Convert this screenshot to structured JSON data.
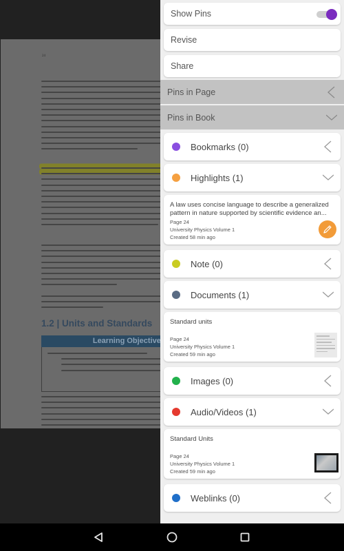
{
  "reader": {
    "page_number": "24",
    "section_heading": "1.2 | Units and Standards",
    "learning_box_label": "Learning Objectives",
    "highlight_color": "#86861f"
  },
  "panel": {
    "options": [
      {
        "label": "Show Pins",
        "toggle": true,
        "toggle_on": true
      },
      {
        "label": "Revise"
      },
      {
        "label": "Share"
      }
    ],
    "sections": [
      {
        "label": "Pins in Page",
        "state": "collapsed"
      },
      {
        "label": "Pins in Book",
        "state": "expanded"
      }
    ],
    "categories": [
      {
        "label": "Bookmarks (0)",
        "color": "#8a4fe0",
        "state": "collapsed"
      },
      {
        "label": "Highlights (1)",
        "color": "#f5a041",
        "state": "expanded",
        "item": {
          "title": "A law uses concise language to describe a generalized pattern in nature supported by scientific evidence an...",
          "page": "Page 24",
          "book": "University Physics Volume 1",
          "created": "Created 58 min ago",
          "action_icon": "edit-pencil-icon"
        }
      },
      {
        "label": "Note (0)",
        "color": "#c9cc22",
        "state": "collapsed"
      },
      {
        "label": "Documents (1)",
        "color": "#5a6c84",
        "state": "expanded",
        "item": {
          "title": "Standard units",
          "page": "Page 24",
          "book": "University Physics Volume 1",
          "created": "Created 59 min ago",
          "thumbnail": "document-thumbnail"
        }
      },
      {
        "label": "Images (0)",
        "color": "#22b14c",
        "state": "collapsed"
      },
      {
        "label": "Audio/Videos (1)",
        "color": "#e53a2f",
        "state": "expanded",
        "item": {
          "title": "Standard Units",
          "page": "Page 24",
          "book": "University Physics Volume 1",
          "created": "Created 59 min ago",
          "thumbnail": "video-thumbnail"
        }
      },
      {
        "label": "Weblinks (0)",
        "color": "#1f6fc9",
        "state": "collapsed"
      }
    ],
    "accent_color": "#7b2cbf"
  },
  "navbar": {
    "buttons": [
      "back",
      "home",
      "recents"
    ]
  }
}
